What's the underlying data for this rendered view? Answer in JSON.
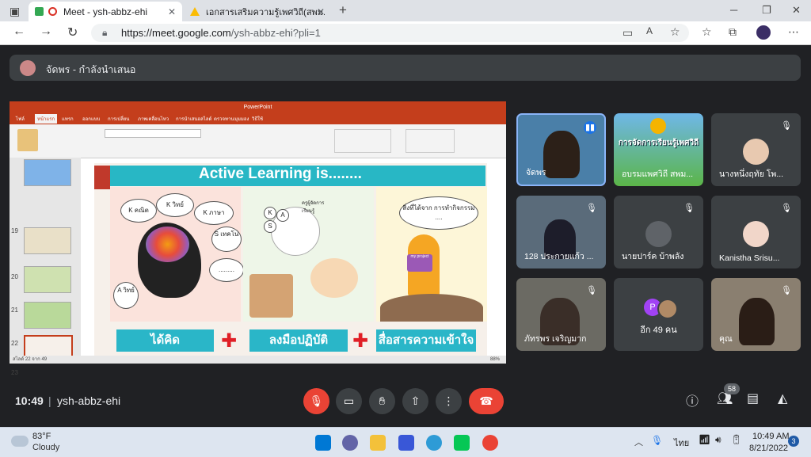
{
  "browser": {
    "tabs": [
      {
        "title": "Meet - ysh-abbz-ehi",
        "active": true
      },
      {
        "title": "เอกสารเสริมความรู้เพศวิถี(สพม.ลพบ)",
        "active": false
      }
    ],
    "url_host": "https://meet.google.com",
    "url_path": "/ysh-abbz-ehi?pli=1"
  },
  "meet": {
    "presenter_label": "จัดพร - กำลังนำเสนอ",
    "meeting_time": "10:49",
    "meeting_code": "ysh-abbz-ehi",
    "participant_count": "58",
    "presentation": {
      "window_title": "PowerPoint",
      "ribbon_tabs": [
        "ไฟล์",
        "หน้าแรก",
        "แทรก",
        "ออกแบบ",
        "การเปลี่ยน",
        "ภาพเคลื่อนไหว",
        "การนำเสนอสไลด์",
        "ตรวจทาน",
        "มุมมอง",
        "วิธีใช้"
      ],
      "thumbnail_numbers": [
        "19",
        "20",
        "21",
        "22",
        "23"
      ],
      "slide": {
        "title": "Active Learning is........",
        "bubbles": [
          "K คณิต",
          "K วิทย์",
          "K ภาษา",
          "S เทคโน",
          "A วิทย์",
          "........."
        ],
        "middle_bubble": "ครูผู้จัดการเรียนรู้",
        "middle_letters": [
          "K",
          "A",
          "S"
        ],
        "right_bubble": "สิ่งที่ได้จาก การทำกิจกรรม ....",
        "right_badge": "my project",
        "bottom_labels": [
          "ได้คิด",
          "ลงมือปฏิบัติ",
          "สื่อสารความเข้าใจ"
        ]
      },
      "status_left": "สไลด์ 22 จาก 49",
      "status_zoom": "88%"
    },
    "tiles": [
      {
        "name": "จัดพร",
        "speaking": true
      },
      {
        "name": "อบรมแพศวิถี สพม...",
        "banner": "การจัดการเรียนรู้เพศวิถี"
      },
      {
        "name": "นางหนึ่งฤทัย โพ..."
      },
      {
        "name": "128 ประกายแก้ว ..."
      },
      {
        "name": "นายปาร์ค บ้าพลัง"
      },
      {
        "name": "Kanistha Srisu..."
      },
      {
        "name": "ภัทรพร เจริญมาก"
      },
      {
        "name": "อีก 49 คน",
        "avatar_letter": "P"
      },
      {
        "name": "คุณ"
      }
    ]
  },
  "taskbar": {
    "weather_temp": "83°F",
    "weather_desc": "Cloudy",
    "language": "ไทย",
    "clock_time": "10:49 AM",
    "clock_date": "8/21/2022",
    "notification_count": "3"
  }
}
